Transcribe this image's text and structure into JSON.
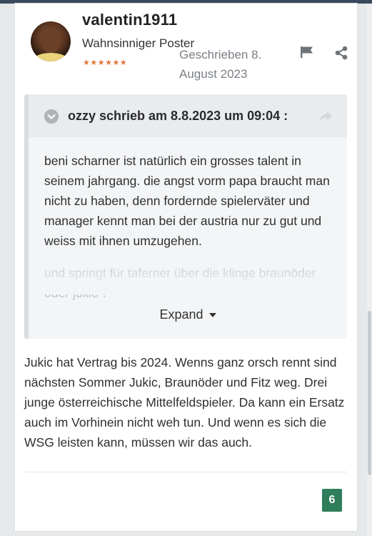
{
  "post": {
    "author": {
      "username": "valentin1911",
      "rank": "Wahnsinniger Poster",
      "stars": "★★★★★★"
    },
    "posted_label": "Geschrieben 8. August 2023",
    "quote": {
      "author_line": "ozzy schrieb am 8.8.2023 um 09:04 :",
      "text": "beni scharner ist natürlich ein grosses talent in seinem jahrgang. die angst vorm papa braucht man nicht zu haben, denn fordernde spielerväter und manager kennt man bei der austria nur zu gut und weiss mit ihnen umzugehen.",
      "text_more": "und springt für taferner über die klinge braunöder oder jukic ?",
      "expand_label": "Expand"
    },
    "body": "Jukic hat Vertrag bis 2024. Wenns ganz orsch rennt sind nächsten Sommer Jukic, Braunöder und Fitz weg. Drei junge österreichische Mittelfeldspieler. Da kann ein Ersatz auch im Vorhinein nicht weh tun. Und wenn es sich die WSG leisten kann, müssen wir das auch.",
    "reaction_count": "6"
  },
  "icons": {
    "report": "flag-icon",
    "share": "share-icon",
    "quote_toggle": "chevron-down-circle-icon",
    "quote_goto": "share-arrow-icon",
    "expand_caret": "caret-down-icon"
  },
  "colors": {
    "reaction_badge": "#2f7d5a",
    "stars": "#e07a3a",
    "muted_text": "#7a7f85"
  }
}
